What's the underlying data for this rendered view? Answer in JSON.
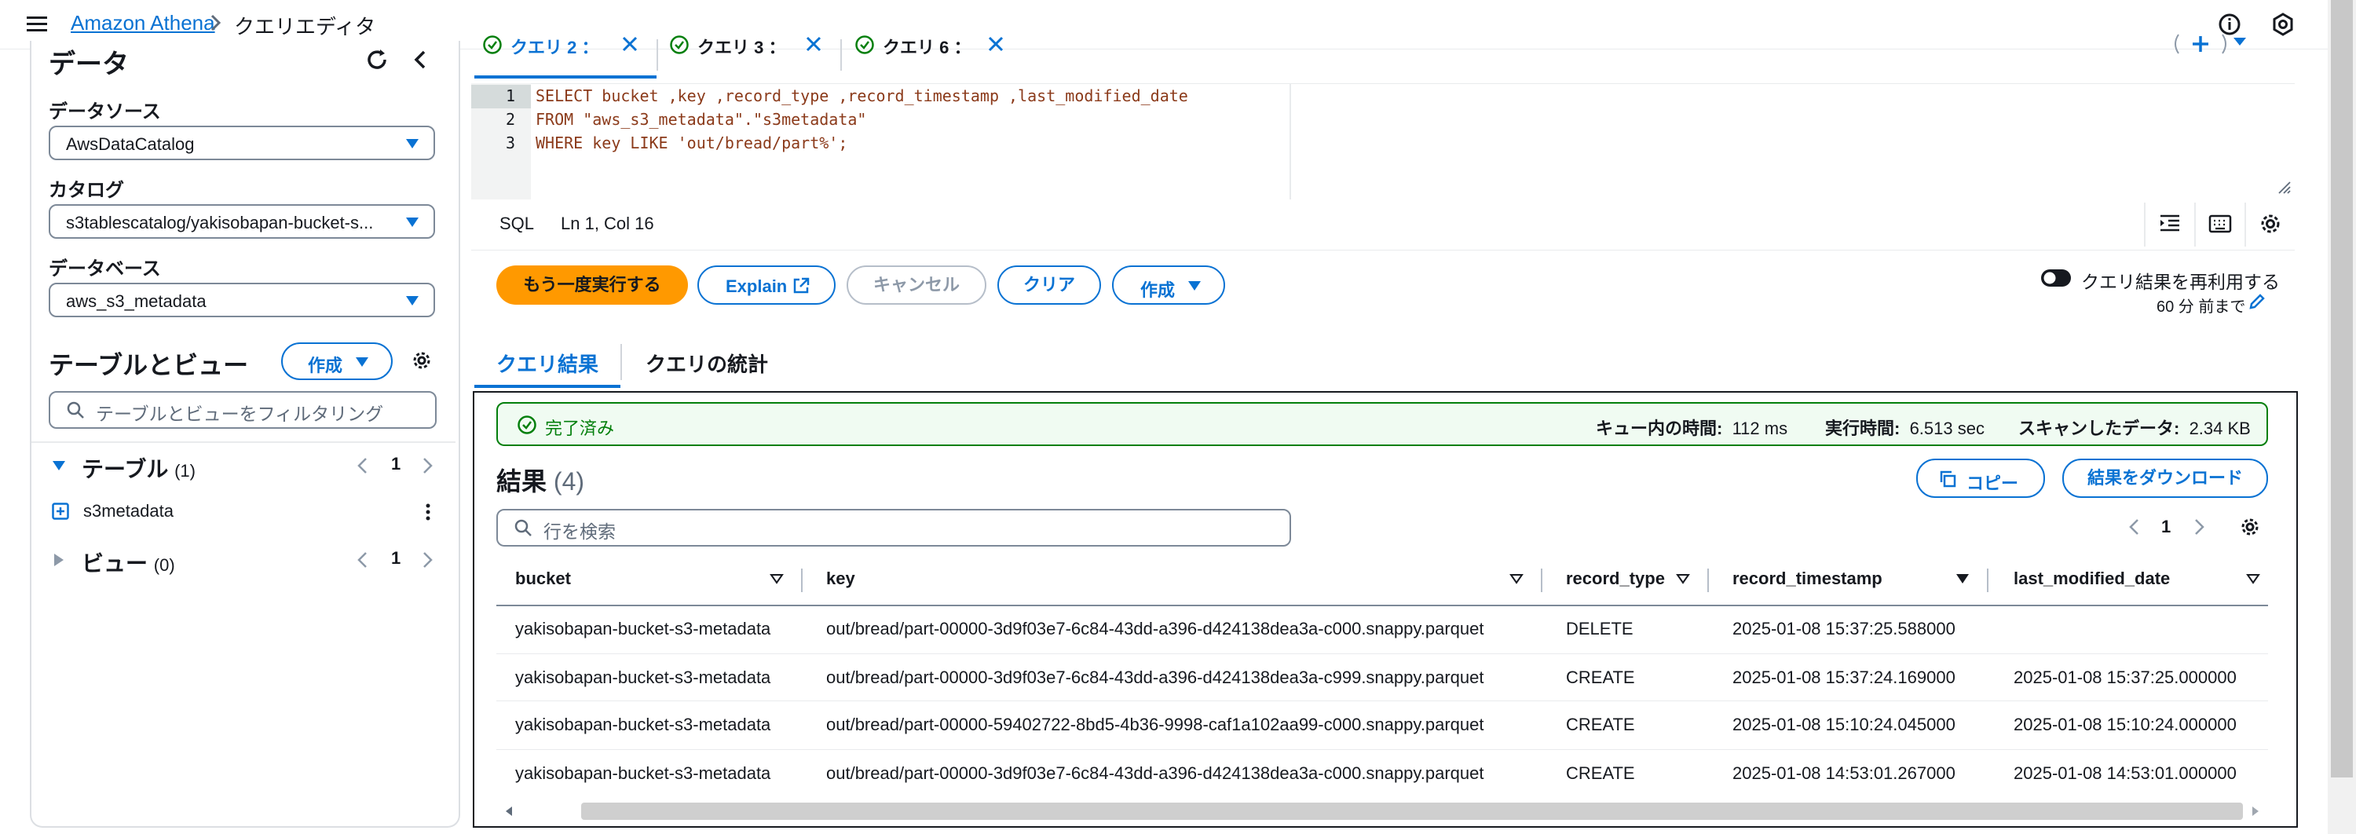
{
  "header": {
    "breadcrumb_root": "Amazon Athena",
    "breadcrumb_current": "クエリエディタ"
  },
  "left_panel": {
    "title": "データ",
    "data_source_label": "データソース",
    "data_source_value": "AwsDataCatalog",
    "catalog_label": "カタログ",
    "catalog_value": "s3tablescatalog/yakisobapan-bucket-s...",
    "database_label": "データベース",
    "database_value": "aws_s3_metadata",
    "tables_views_title": "テーブルとビュー",
    "create_button": "作成",
    "filter_placeholder": "テーブルとビューをフィルタリング",
    "tables_section": {
      "label": "テーブル",
      "count": "(1)",
      "page": "1"
    },
    "tables": [
      "s3metadata"
    ],
    "views_section": {
      "label": "ビュー",
      "count": "(0)",
      "page": "1"
    }
  },
  "editor_tabs": [
    {
      "label": "クエリ 2 ："
    },
    {
      "label": "クエリ 3 ："
    },
    {
      "label": "クエリ 6 ："
    }
  ],
  "editor": {
    "line_numbers": [
      "1",
      "2",
      "3"
    ],
    "lines": [
      "SELECT bucket ,key ,record_type ,record_timestamp ,last_modified_date",
      "FROM \"aws_s3_metadata\".\"s3metadata\"",
      "WHERE key LIKE 'out/bread/part%';"
    ]
  },
  "status_bar": {
    "language": "SQL",
    "cursor": "Ln 1, Col 16"
  },
  "actions": {
    "run_again": "もう一度実行する",
    "explain": "Explain",
    "cancel": "キャンセル",
    "clear": "クリア",
    "create": "作成",
    "reuse_label": "クエリ結果を再利用する",
    "reuse_sub": "60 分 前まで"
  },
  "result_tabs": {
    "results": "クエリ結果",
    "stats": "クエリの統計"
  },
  "results": {
    "status": "完了済み",
    "queue_label": "キュー内の時間:",
    "queue_value": "112 ms",
    "exec_label": "実行時間:",
    "exec_value": "6.513 sec",
    "scan_label": "スキャンしたデータ:",
    "scan_value": "2.34 KB",
    "title": "結果",
    "count": "(4)",
    "copy_button": "コピー",
    "download_button": "結果をダウンロード",
    "search_placeholder": "行を検索",
    "page": "1",
    "columns": [
      "bucket",
      "key",
      "record_type",
      "record_timestamp",
      "last_modified_date"
    ],
    "rows": [
      [
        "yakisobapan-bucket-s3-metadata",
        "out/bread/part-00000-3d9f03e7-6c84-43dd-a396-d424138dea3a-c000.snappy.parquet",
        "DELETE",
        "2025-01-08 15:37:25.588000",
        ""
      ],
      [
        "yakisobapan-bucket-s3-metadata",
        "out/bread/part-00000-3d9f03e7-6c84-43dd-a396-d424138dea3a-c999.snappy.parquet",
        "CREATE",
        "2025-01-08 15:37:24.169000",
        "2025-01-08 15:37:25.000000"
      ],
      [
        "yakisobapan-bucket-s3-metadata",
        "out/bread/part-00000-59402722-8bd5-4b36-9998-caf1a102aa99-c000.snappy.parquet",
        "CREATE",
        "2025-01-08 15:10:24.045000",
        "2025-01-08 15:10:24.000000"
      ],
      [
        "yakisobapan-bucket-s3-metadata",
        "out/bread/part-00000-3d9f03e7-6c84-43dd-a396-d424138dea3a-c000.snappy.parquet",
        "CREATE",
        "2025-01-08 14:53:01.267000",
        "2025-01-08 14:53:01.000000"
      ]
    ]
  },
  "colors": {
    "accent": "#0972d3",
    "primary_button": "#ff9900",
    "success": "#037f0c",
    "success_bg": "#f0fbf2",
    "sql_text": "#8b3a1a"
  }
}
